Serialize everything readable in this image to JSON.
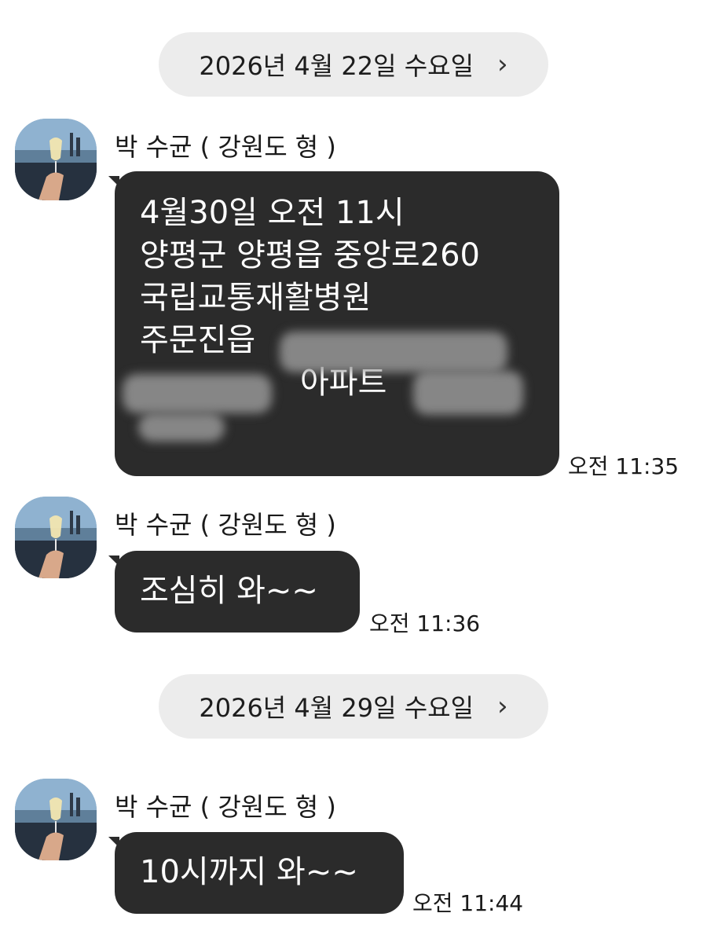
{
  "dates": [
    {
      "label": "2026년 4월 22일 수요일"
    },
    {
      "label": "2026년 4월 29일 수요일"
    }
  ],
  "messages": [
    {
      "sender": "박 수균 ( 강원도 형 )",
      "lines": [
        "4월30일 오전 11시",
        "양평군 양평읍 중앙로260",
        "국립교통재활병원",
        "주문진읍 ",
        "아파트"
      ],
      "time": "오전 11:35"
    },
    {
      "sender": "박 수균 ( 강원도 형 )",
      "text": "조심히 와~~",
      "time": "오전 11:36"
    },
    {
      "sender": "박 수균 ( 강원도 형 )",
      "text": "10시까지 와~~",
      "time": "오전 11:44"
    }
  ],
  "icons": {
    "chevron": "chevron-right-icon",
    "avatar": "profile-avatar"
  },
  "colors": {
    "bubble": "#2b2b2b",
    "date_pill": "#ececec",
    "background": "#ffffff"
  }
}
